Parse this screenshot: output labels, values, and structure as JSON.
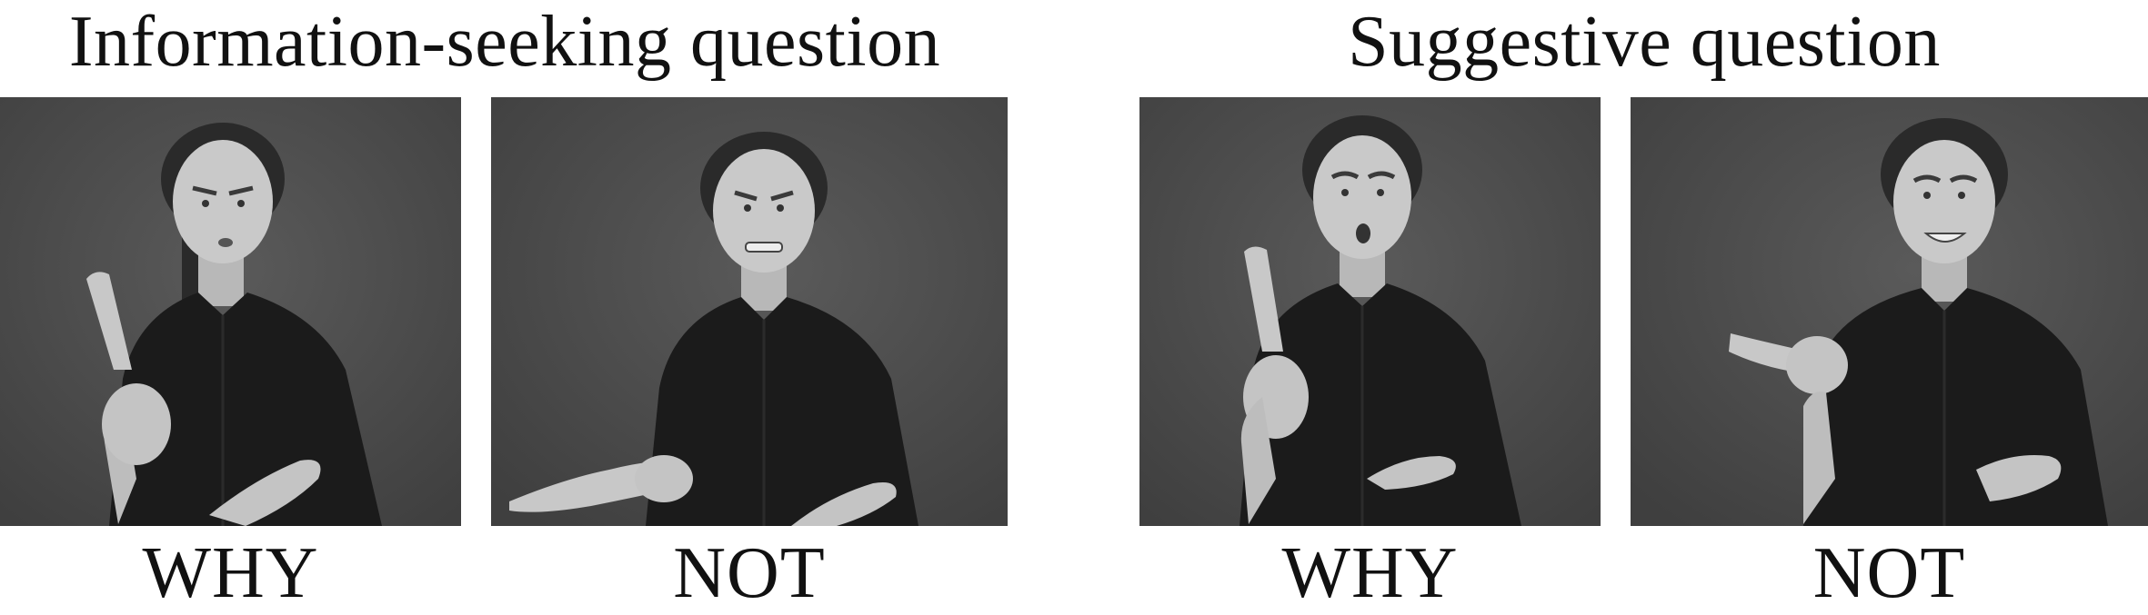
{
  "titles": {
    "left": "Information-seeking question",
    "right": "Suggestive question"
  },
  "panels": [
    {
      "label": "WHY",
      "expression": "furrowed-brow",
      "sign": "index-up"
    },
    {
      "label": "NOT",
      "expression": "grimace",
      "sign": "point-side"
    },
    {
      "label": "WHY",
      "expression": "raised-brow-open-mouth",
      "sign": "index-up"
    },
    {
      "label": "NOT",
      "expression": "smile-raised-brow",
      "sign": "point-side"
    }
  ],
  "colors": {
    "background": "#ffffff",
    "photo_backdrop": "#4d4d4d",
    "shirt": "#1b1b1b",
    "skin": "#c9c9c9",
    "text": "#111111"
  }
}
